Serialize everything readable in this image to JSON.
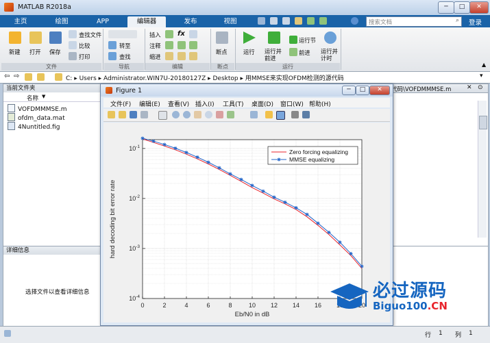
{
  "window": {
    "title": "MATLAB R2018a"
  },
  "tabs": [
    "主页",
    "绘图",
    "APP",
    "编辑器",
    "发布",
    "视图"
  ],
  "active_tab": "编辑器",
  "search": {
    "placeholder": "搜索文档"
  },
  "login_label": "登录",
  "ribbon": {
    "file": {
      "new": "新建",
      "open": "打开",
      "save": "保存",
      "find_files": "查找文件",
      "compare": "比较",
      "print": "打印",
      "group": "文件"
    },
    "nav": {
      "goto": "转至",
      "find": "查找",
      "group": "导航"
    },
    "edit": {
      "insert": "插入",
      "comment": "注释",
      "indent": "缩进",
      "fx": "fx",
      "group": "编辑"
    },
    "breakpoints": {
      "label": "断点",
      "group": "断点"
    },
    "run": {
      "run": "运行",
      "run_advance": "运行并前进",
      "run_section": "运行节",
      "advance": "前进",
      "run_time": "运行并计时",
      "group": "运行"
    }
  },
  "address": {
    "path": [
      "C:",
      "Users",
      "Administrator.WIN7U-20180127Z",
      "Desktop",
      "用MMSE来实现OFDM检测的源代码"
    ]
  },
  "current_folder": {
    "header": "当前文件夹",
    "column": "名称",
    "files": [
      "VOFDMMMSE.m",
      "ofdm_data.mat",
      "4Nuntitled.fig"
    ]
  },
  "details": {
    "header": "详细信息",
    "hint": "选择文件以查看详细信息"
  },
  "editor_tab": {
    "label": "代码\\VOFDMMMSE.m"
  },
  "figure": {
    "title": "Figure 1",
    "menu": [
      "文件(F)",
      "编辑(E)",
      "查看(V)",
      "插入(I)",
      "工具(T)",
      "桌面(D)",
      "窗口(W)",
      "帮助(H)"
    ]
  },
  "status": {
    "row_label": "行",
    "row": "1",
    "col_label": "列",
    "col": "1"
  },
  "watermark": {
    "title": "必过源码",
    "url_main": "Biguo100",
    "url_suffix": ".CN"
  },
  "chart_data": {
    "type": "line",
    "xlabel": "Eb/N0 in dB",
    "ylabel": "hard decoding bit error rate",
    "xlim": [
      0,
      20
    ],
    "ylim": [
      0.0001,
      0.15
    ],
    "yscale": "log",
    "xticks": [
      0,
      2,
      4,
      6,
      8,
      10,
      12,
      14,
      16,
      18,
      20
    ],
    "grid": true,
    "legend_position": "top-right",
    "x": [
      0,
      1,
      2,
      3,
      4,
      5,
      6,
      7,
      8,
      9,
      10,
      11,
      12,
      13,
      14,
      15,
      16,
      17,
      18,
      19,
      20
    ],
    "series": [
      {
        "name": "Zero forcing equalizing",
        "color": "#e8232b",
        "marker": "none",
        "values": [
          0.155,
          0.132,
          0.112,
          0.094,
          0.077,
          0.062,
          0.049,
          0.038,
          0.029,
          0.022,
          0.0165,
          0.0128,
          0.0098,
          0.0078,
          0.006,
          0.0043,
          0.0029,
          0.0019,
          0.00118,
          0.00072,
          0.0004
        ]
      },
      {
        "name": "MMSE equalizing",
        "color": "#2264c8",
        "marker": "*",
        "values": [
          0.16,
          0.14,
          0.12,
          0.101,
          0.083,
          0.067,
          0.053,
          0.041,
          0.031,
          0.024,
          0.0182,
          0.014,
          0.0106,
          0.0084,
          0.0065,
          0.0048,
          0.0032,
          0.0021,
          0.00133,
          0.00079,
          0.00044
        ]
      }
    ]
  },
  "colors": {
    "tabbar": "#1a63a8",
    "accent_red": "#e8232b",
    "accent_blue": "#2264c8"
  }
}
